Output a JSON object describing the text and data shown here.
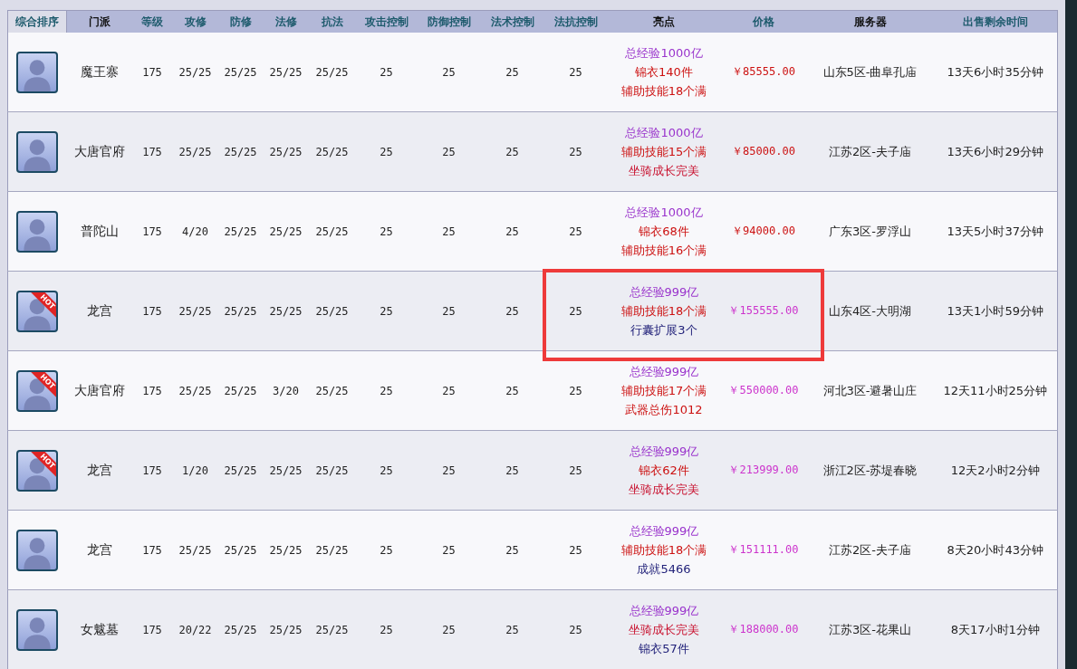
{
  "columns": [
    {
      "label": "综合排序",
      "sortable": true,
      "selected": true
    },
    {
      "label": "门派",
      "sortable": false,
      "selected": false
    },
    {
      "label": "等级",
      "sortable": true,
      "selected": false
    },
    {
      "label": "攻修",
      "sortable": true,
      "selected": false
    },
    {
      "label": "防修",
      "sortable": true,
      "selected": false
    },
    {
      "label": "法修",
      "sortable": true,
      "selected": false
    },
    {
      "label": "抗法",
      "sortable": true,
      "selected": false
    },
    {
      "label": "攻击控制",
      "sortable": true,
      "selected": false
    },
    {
      "label": "防御控制",
      "sortable": true,
      "selected": false
    },
    {
      "label": "法术控制",
      "sortable": true,
      "selected": false
    },
    {
      "label": "法抗控制",
      "sortable": true,
      "selected": false
    },
    {
      "label": "亮点",
      "sortable": false,
      "selected": false
    },
    {
      "label": "价格",
      "sortable": true,
      "selected": false
    },
    {
      "label": "服务器",
      "sortable": false,
      "selected": false
    },
    {
      "label": "出售剩余时间",
      "sortable": true,
      "selected": false
    }
  ],
  "rows": [
    {
      "school": "魔王寨",
      "level": "175",
      "atk": "25/25",
      "def": "25/25",
      "mag": "25/25",
      "res": "25/25",
      "c1": "25",
      "c2": "25",
      "c3": "25",
      "c4": "25",
      "highlights": [
        {
          "text": "总经验1000亿",
          "color": "#9933cc"
        },
        {
          "text": "锦衣140件",
          "color": "#cc1111"
        },
        {
          "text": "辅助技能18个满",
          "color": "#cc1111"
        }
      ],
      "price": {
        "text": "￥85555.00",
        "color": "#cc1111"
      },
      "server": "山东5区-曲阜孔庙",
      "time": "13天6小时35分钟"
    },
    {
      "school": "大唐官府",
      "level": "175",
      "atk": "25/25",
      "def": "25/25",
      "mag": "25/25",
      "res": "25/25",
      "c1": "25",
      "c2": "25",
      "c3": "25",
      "c4": "25",
      "highlights": [
        {
          "text": "总经验1000亿",
          "color": "#9933cc"
        },
        {
          "text": "辅助技能15个满",
          "color": "#cc1111"
        },
        {
          "text": "坐骑成长完美",
          "color": "#c8102e"
        }
      ],
      "price": {
        "text": "￥85000.00",
        "color": "#cc1111"
      },
      "server": "江苏2区-夫子庙",
      "time": "13天6小时29分钟"
    },
    {
      "school": "普陀山",
      "level": "175",
      "atk": "4/20",
      "def": "25/25",
      "mag": "25/25",
      "res": "25/25",
      "c1": "25",
      "c2": "25",
      "c3": "25",
      "c4": "25",
      "highlights": [
        {
          "text": "总经验1000亿",
          "color": "#9933cc"
        },
        {
          "text": "锦衣68件",
          "color": "#cc1111"
        },
        {
          "text": "辅助技能16个满",
          "color": "#cc1111"
        }
      ],
      "price": {
        "text": "￥94000.00",
        "color": "#cc1111"
      },
      "server": "广东3区-罗浮山",
      "time": "13天5小时37分钟"
    },
    {
      "badge": "HOT",
      "school": "龙宫",
      "level": "175",
      "atk": "25/25",
      "def": "25/25",
      "mag": "25/25",
      "res": "25/25",
      "c1": "25",
      "c2": "25",
      "c3": "25",
      "c4": "25",
      "highlights": [
        {
          "text": "总经验999亿",
          "color": "#9933cc"
        },
        {
          "text": "辅助技能18个满",
          "color": "#cc1111"
        },
        {
          "text": "行囊扩展3个",
          "color": "#22227a"
        }
      ],
      "price": {
        "text": "￥155555.00",
        "color": "#cc33cc"
      },
      "server": "山东4区-大明湖",
      "time": "13天1小时59分钟"
    },
    {
      "badge": "HOT",
      "school": "大唐官府",
      "level": "175",
      "atk": "25/25",
      "def": "25/25",
      "mag": "3/20",
      "res": "25/25",
      "c1": "25",
      "c2": "25",
      "c3": "25",
      "c4": "25",
      "highlights": [
        {
          "text": "总经验999亿",
          "color": "#9933cc"
        },
        {
          "text": "辅助技能17个满",
          "color": "#cc1111"
        },
        {
          "text": "武器总伤1012",
          "color": "#cc1111"
        }
      ],
      "price": {
        "text": "￥550000.00",
        "color": "#cc33cc"
      },
      "server": "河北3区-避暑山庄",
      "time": "12天11小时25分钟"
    },
    {
      "badge": "HOT",
      "school": "龙宫",
      "level": "175",
      "atk": "1/20",
      "def": "25/25",
      "mag": "25/25",
      "res": "25/25",
      "c1": "25",
      "c2": "25",
      "c3": "25",
      "c4": "25",
      "highlights": [
        {
          "text": "总经验999亿",
          "color": "#9933cc"
        },
        {
          "text": "锦衣62件",
          "color": "#cc1111"
        },
        {
          "text": "坐骑成长完美",
          "color": "#c8102e"
        }
      ],
      "price": {
        "text": "￥213999.00",
        "color": "#cc33cc"
      },
      "server": "浙江2区-苏堤春晓",
      "time": "12天2小时2分钟"
    },
    {
      "school": "龙宫",
      "level": "175",
      "atk": "25/25",
      "def": "25/25",
      "mag": "25/25",
      "res": "25/25",
      "c1": "25",
      "c2": "25",
      "c3": "25",
      "c4": "25",
      "highlights": [
        {
          "text": "总经验999亿",
          "color": "#9933cc"
        },
        {
          "text": "辅助技能18个满",
          "color": "#cc1111"
        },
        {
          "text": "成就5466",
          "color": "#22227a"
        }
      ],
      "price": {
        "text": "￥151111.00",
        "color": "#cc33cc"
      },
      "server": "江苏2区-夫子庙",
      "time": "8天20小时43分钟"
    },
    {
      "school": "女魃墓",
      "level": "175",
      "atk": "20/22",
      "def": "25/25",
      "mag": "25/25",
      "res": "25/25",
      "c1": "25",
      "c2": "25",
      "c3": "25",
      "c4": "25",
      "highlights": [
        {
          "text": "总经验999亿",
          "color": "#9933cc"
        },
        {
          "text": "坐骑成长完美",
          "color": "#c8102e"
        },
        {
          "text": "锦衣57件",
          "color": "#22227a"
        }
      ],
      "price": {
        "text": "￥188000.00",
        "color": "#cc33cc"
      },
      "server": "江苏3区-花果山",
      "time": "8天17小时1分钟"
    }
  ]
}
